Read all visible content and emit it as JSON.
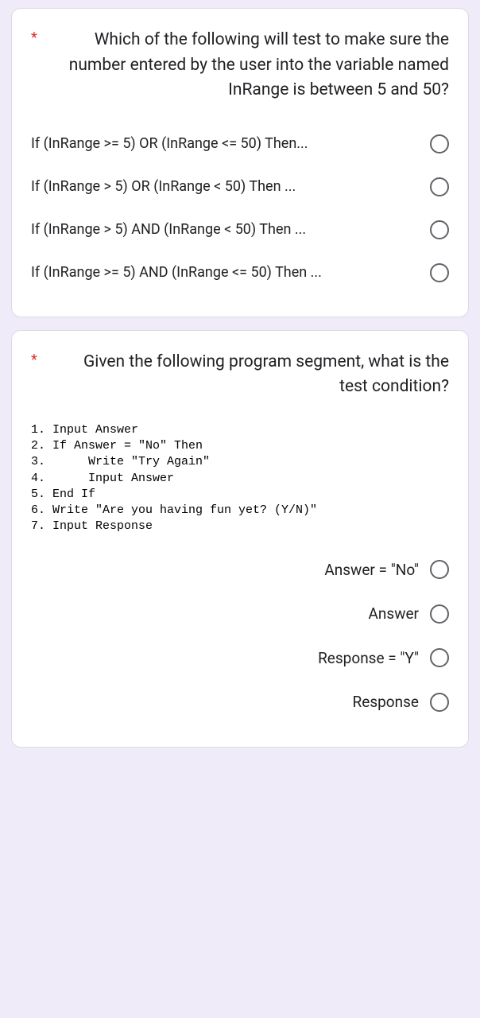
{
  "question1": {
    "required_marker": "*",
    "text": "Which of the following will test to make sure the number entered by the user into the variable named InRange is between 5 and 50?",
    "options": [
      "If (InRange >= 5) OR (InRange <= 50) Then...",
      "If (InRange > 5) OR (InRange < 50) Then ...",
      "If (InRange > 5) AND (InRange < 50) Then ...",
      "If (InRange >= 5) AND (InRange <= 50) Then ..."
    ]
  },
  "question2": {
    "required_marker": "*",
    "text": "Given the following program segment, what is the test condition?",
    "code": "1. Input Answer\n2. If Answer = \"No\" Then\n3.      Write \"Try Again\"\n4.      Input Answer\n5. End If\n6. Write \"Are you having fun yet? (Y/N)\"\n7. Input Response",
    "options": [
      "Answer = \"No\"",
      "Answer",
      "Response = \"Y\"",
      "Response"
    ]
  }
}
